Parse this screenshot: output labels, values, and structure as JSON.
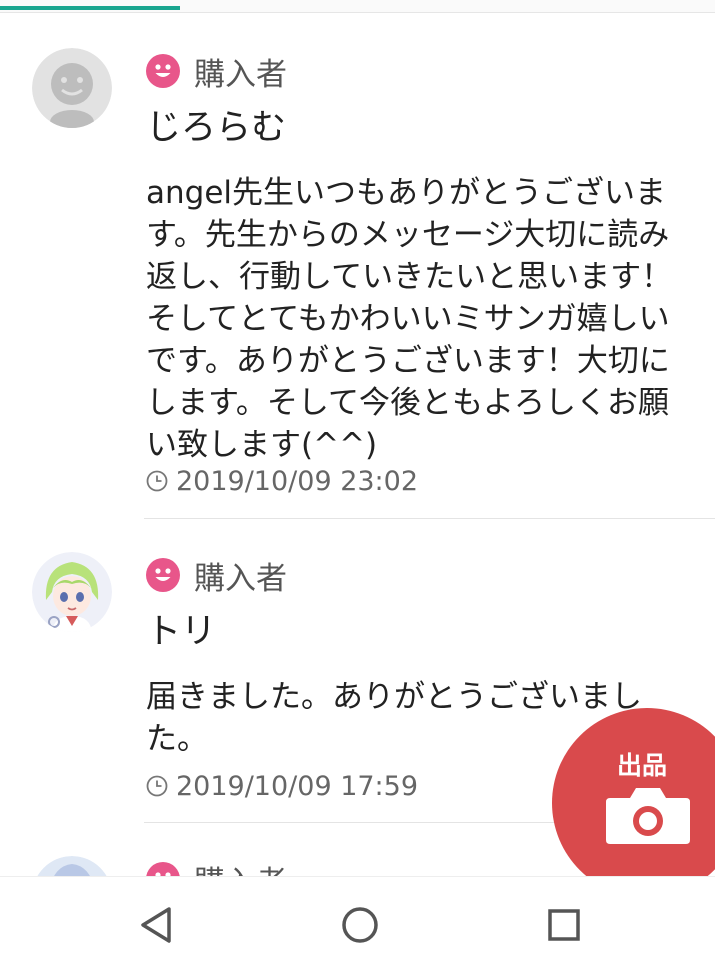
{
  "theme": {
    "accent": "#1aa58f",
    "badge": "#e8568a",
    "fab": "#d94a4c",
    "nav_icon": "#555555"
  },
  "reviews": [
    {
      "avatar": "default-avatar-icon",
      "role_icon": "smile-icon",
      "role": "購入者",
      "name": "じろらむ",
      "message": "angel先生いつもありがとうございます。先生からのメッセージ大切に読み返し、行動していきたいと思います！そしてとてもかわいいミサンガ嬉しいです。ありがとうございます！大切にします。そして今後ともよろしくお願い致します(^^)",
      "time_icon": "clock-icon",
      "time": "2019/10/09 23:02"
    },
    {
      "avatar": "anime-character-avatar",
      "role_icon": "smile-icon",
      "role": "購入者",
      "name": "トリ",
      "message": "届きました。ありがとうございました。",
      "time_icon": "clock-icon",
      "time": "2019/10/09 17:59"
    },
    {
      "avatar": "user-avatar",
      "role_icon": "smile-icon",
      "role": "購入者"
    }
  ],
  "fab": {
    "label": "出品",
    "icon": "camera-icon"
  },
  "navbar": {
    "back_icon": "back-triangle-icon",
    "home_icon": "home-circle-icon",
    "recents_icon": "recents-square-icon"
  }
}
